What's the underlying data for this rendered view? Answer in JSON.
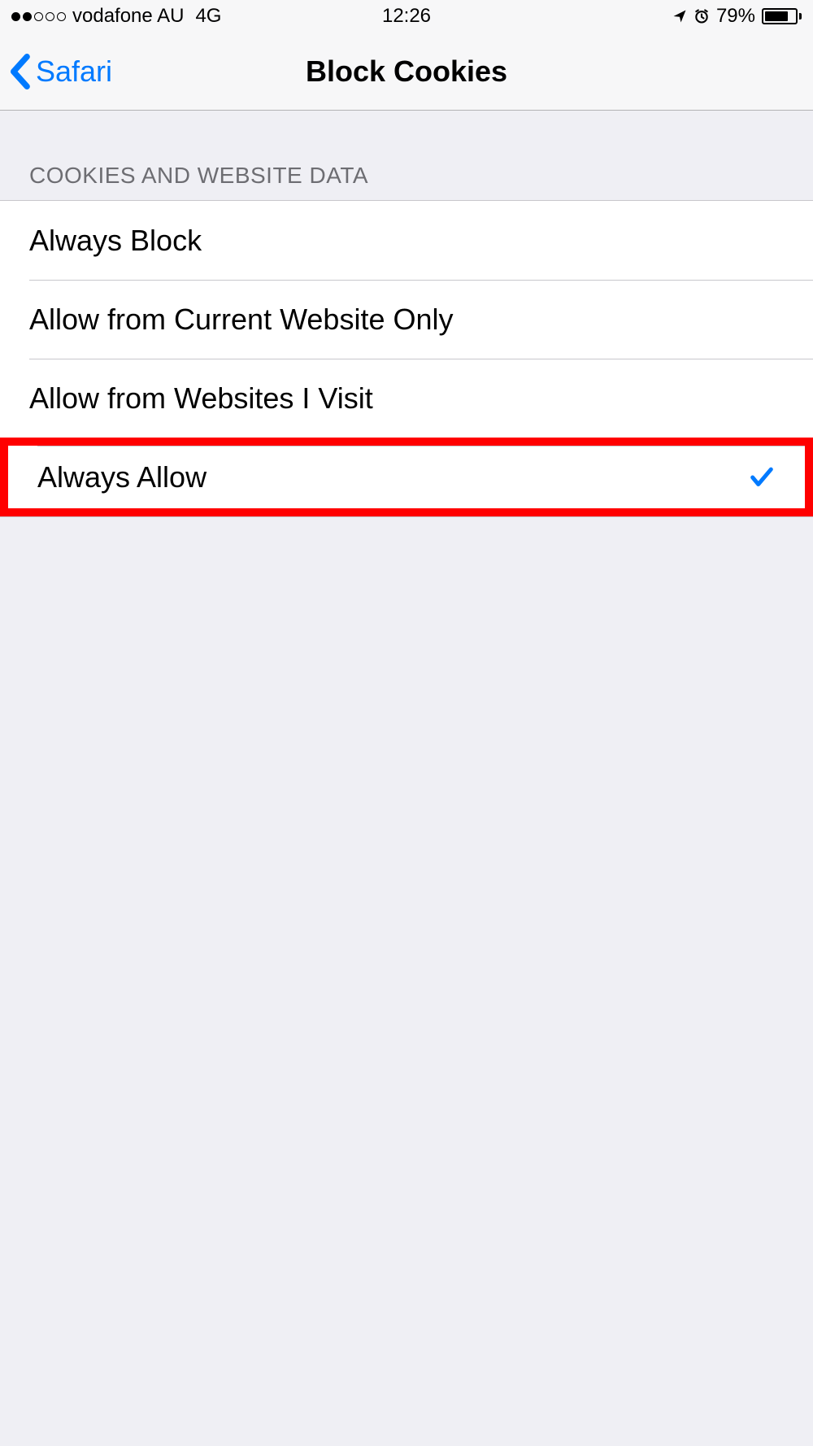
{
  "status": {
    "carrier": "vodafone AU",
    "network": "4G",
    "time": "12:26",
    "battery_percent": "79%"
  },
  "nav": {
    "back_label": "Safari",
    "title": "Block Cookies"
  },
  "section_header": "COOKIES AND WEBSITE DATA",
  "options": [
    {
      "label": "Always Block",
      "selected": false,
      "highlighted": false
    },
    {
      "label": "Allow from Current Website Only",
      "selected": false,
      "highlighted": false
    },
    {
      "label": "Allow from Websites I Visit",
      "selected": false,
      "highlighted": false
    },
    {
      "label": "Always Allow",
      "selected": true,
      "highlighted": true
    }
  ]
}
